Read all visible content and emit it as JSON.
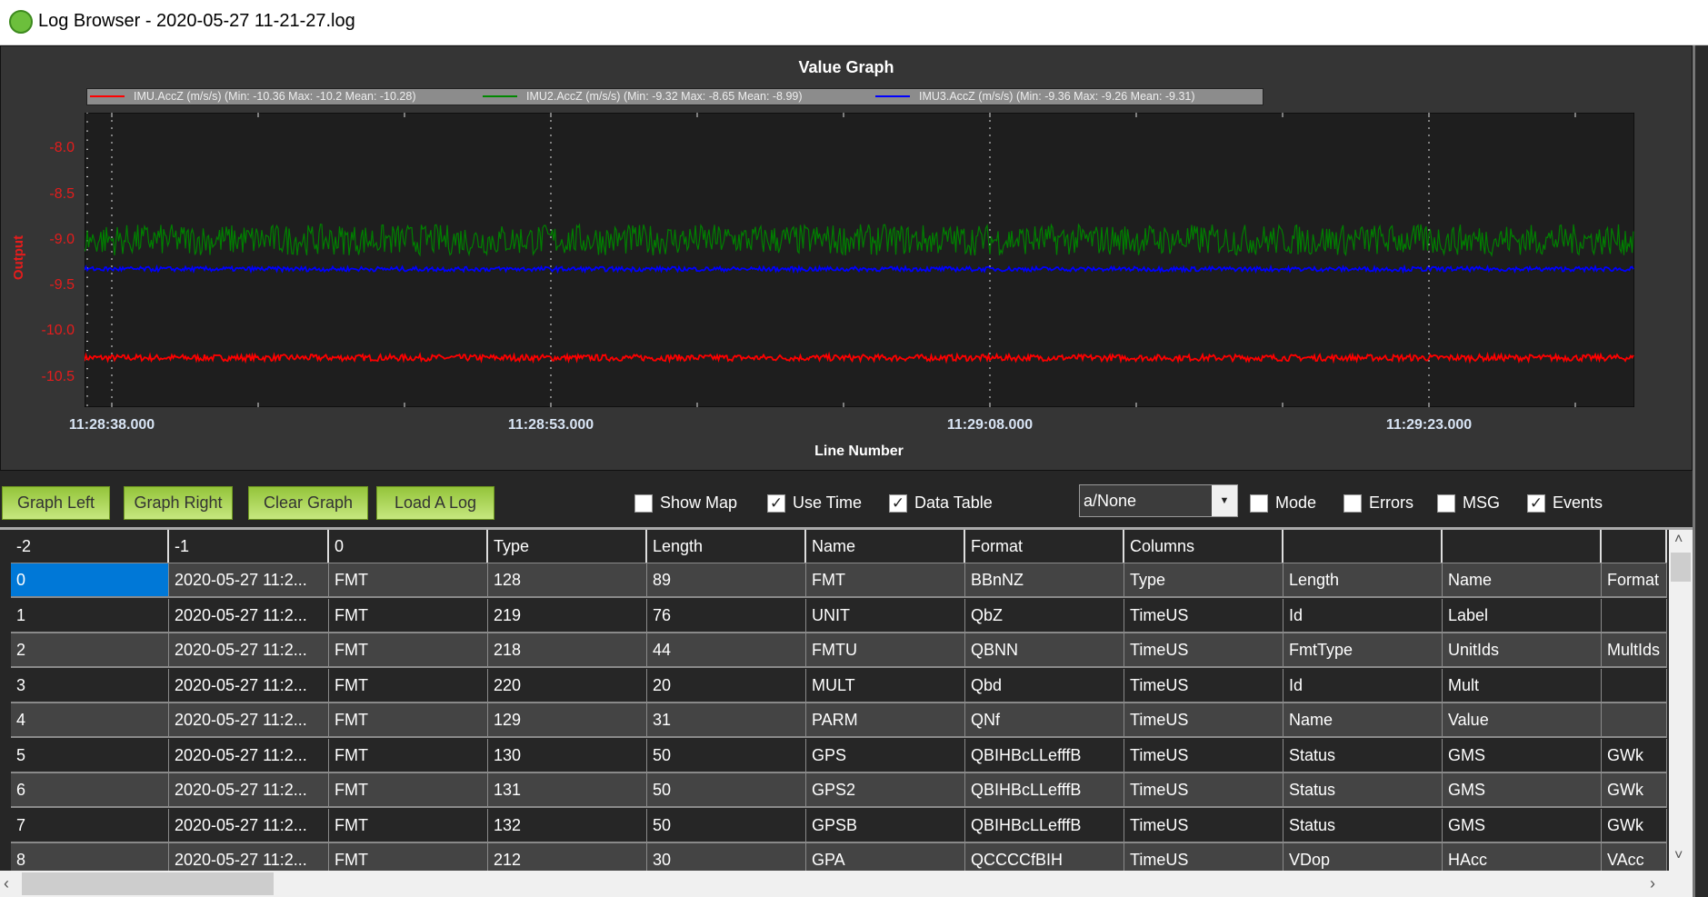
{
  "window": {
    "title": "Log Browser - 2020-05-27 11-21-27.log"
  },
  "chart_data": {
    "type": "line",
    "title": "Value Graph",
    "xlabel": "Line Number",
    "ylabel": "Output",
    "x_range": [
      "11:28:37.07",
      "11:29:30.00"
    ],
    "ylim": [
      -10.82,
      -7.6
    ],
    "xticks": [
      "11:28:38.000",
      "11:28:53.000",
      "11:29:08.000",
      "11:29:23.000"
    ],
    "yticks": [
      "-8.0",
      "-8.5",
      "-9.0",
      "-9.5",
      "-10.0",
      "-10.5"
    ],
    "grid": "x-dotted",
    "legend": "top",
    "series": [
      {
        "name": "IMU.AccZ",
        "label": "IMU.AccZ  (m/s/s)  (Min: -10.36 Max: -10.2 Mean: -10.28)",
        "color": "#ff0000",
        "min": -10.36,
        "max": -10.2,
        "mean": -10.28
      },
      {
        "name": "IMU2.AccZ",
        "label": "IMU2.AccZ  (m/s/s)  (Min: -9.32 Max: -8.65 Mean: -8.99)",
        "color": "#008000",
        "min": -9.32,
        "max": -8.65,
        "mean": -8.99
      },
      {
        "name": "IMU3.AccZ",
        "label": "IMU3.AccZ  (m/s/s)  (Min: -9.36 Max: -9.26 Mean: -9.31)",
        "color": "#0000ff",
        "min": -9.36,
        "max": -9.26,
        "mean": -9.31
      }
    ]
  },
  "toolbar": {
    "buttons": [
      "Graph Left",
      "Graph Right",
      "Clear Graph",
      "Load A Log"
    ],
    "checks": [
      {
        "label": "Show Map",
        "checked": false
      },
      {
        "label": "Use Time",
        "checked": true
      },
      {
        "label": "Data Table",
        "checked": true
      }
    ],
    "combo": "a/None",
    "checks2": [
      {
        "label": "Mode",
        "checked": false
      },
      {
        "label": "Errors",
        "checked": false
      },
      {
        "label": "MSG",
        "checked": false
      },
      {
        "label": "Events",
        "checked": true
      }
    ]
  },
  "table": {
    "headers": [
      "-2",
      "-1",
      "0",
      "Type",
      "Length",
      "Name",
      "Format",
      "Columns",
      "",
      "",
      ""
    ],
    "rows": [
      [
        "0",
        "2020-05-27 11:2...",
        "FMT",
        "128",
        "89",
        "FMT",
        "BBnNZ",
        "Type",
        "Length",
        "Name",
        "Format"
      ],
      [
        "1",
        "2020-05-27 11:2...",
        "FMT",
        "219",
        "76",
        "UNIT",
        "QbZ",
        "TimeUS",
        "Id",
        "Label",
        ""
      ],
      [
        "2",
        "2020-05-27 11:2...",
        "FMT",
        "218",
        "44",
        "FMTU",
        "QBNN",
        "TimeUS",
        "FmtType",
        "UnitIds",
        "MultIds"
      ],
      [
        "3",
        "2020-05-27 11:2...",
        "FMT",
        "220",
        "20",
        "MULT",
        "Qbd",
        "TimeUS",
        "Id",
        "Mult",
        ""
      ],
      [
        "4",
        "2020-05-27 11:2...",
        "FMT",
        "129",
        "31",
        "PARM",
        "QNf",
        "TimeUS",
        "Name",
        "Value",
        ""
      ],
      [
        "5",
        "2020-05-27 11:2...",
        "FMT",
        "130",
        "50",
        "GPS",
        "QBIHBcLLefffB",
        "TimeUS",
        "Status",
        "GMS",
        "GWk"
      ],
      [
        "6",
        "2020-05-27 11:2...",
        "FMT",
        "131",
        "50",
        "GPS2",
        "QBIHBcLLefffB",
        "TimeUS",
        "Status",
        "GMS",
        "GWk"
      ],
      [
        "7",
        "2020-05-27 11:2...",
        "FMT",
        "132",
        "50",
        "GPSB",
        "QBIHBcLLefffB",
        "TimeUS",
        "Status",
        "GMS",
        "GWk"
      ],
      [
        "8",
        "2020-05-27 11:2...",
        "FMT",
        "212",
        "30",
        "GPA",
        "QCCCCfBIH",
        "TimeUS",
        "VDop",
        "HAcc",
        "VAcc"
      ]
    ],
    "selected_cell": "0"
  }
}
